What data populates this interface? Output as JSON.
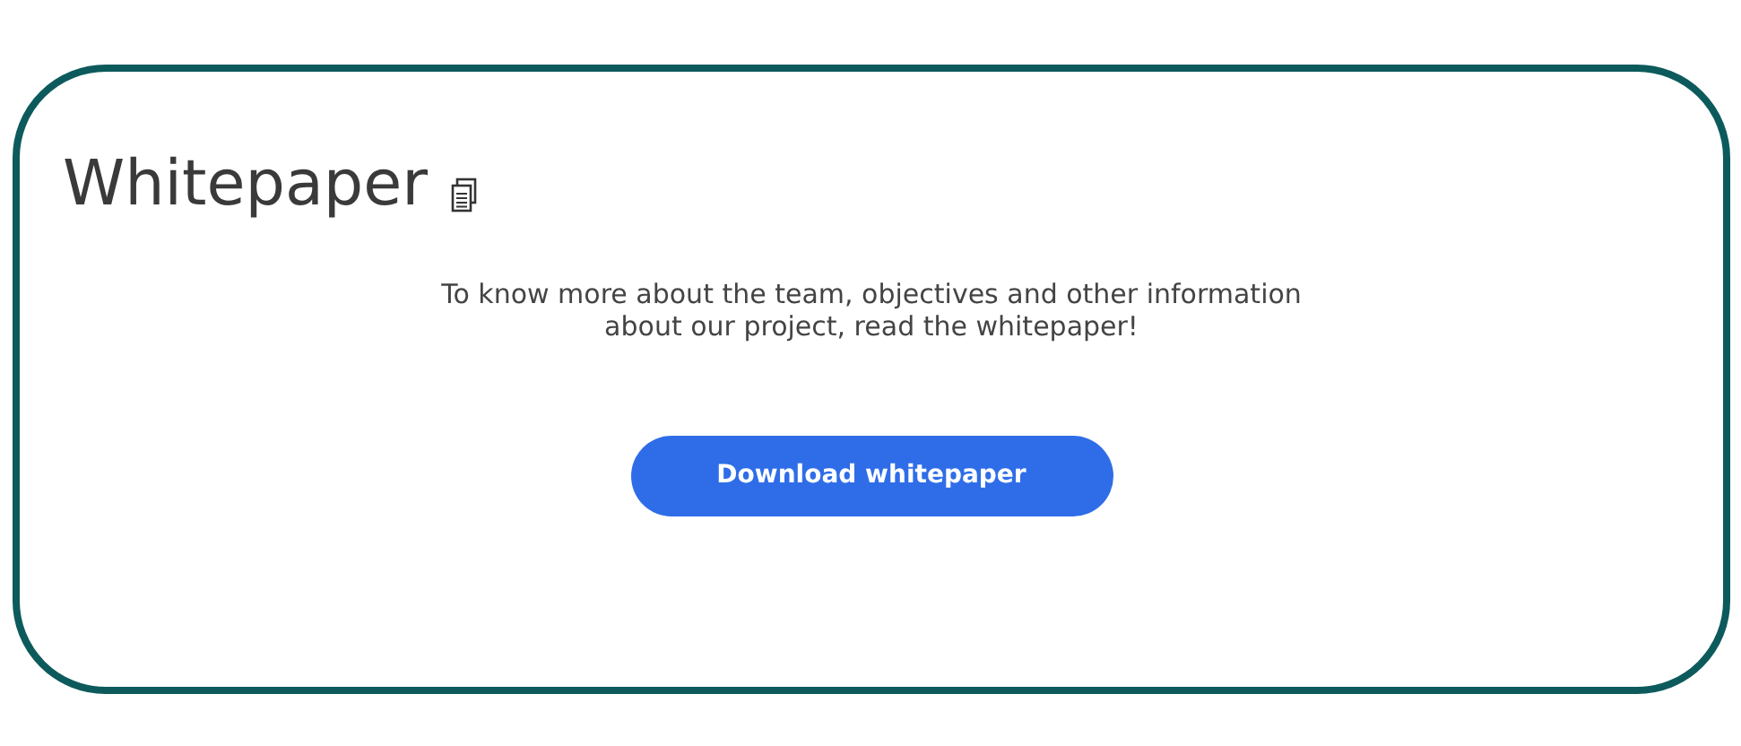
{
  "card": {
    "title": "Whitepaper",
    "description": "To know more about the team, objectives and other information about our project, read the whitepaper!",
    "button": "Download whitepaper"
  }
}
